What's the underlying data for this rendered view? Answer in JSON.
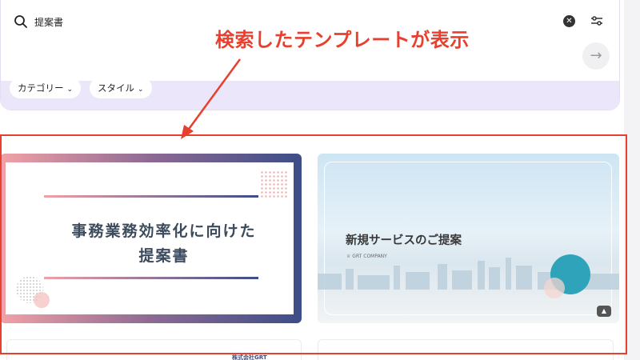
{
  "search": {
    "query": "提案書",
    "icon": "search-icon",
    "clear_icon": "close-circle-icon",
    "filter_icon": "sliders-icon",
    "submit_icon": "arrow-right-icon",
    "submit_glyph": "→",
    "clear_glyph": "✕"
  },
  "filters": [
    {
      "label": "カテゴリー",
      "chevron": "⌄"
    },
    {
      "label": "スタイル",
      "chevron": "⌄"
    }
  ],
  "annotation": {
    "text": "検索したテンプレートが表示",
    "color": "#e8402f"
  },
  "templates": [
    {
      "title_line1": "事務業務効率化に向けた",
      "title_line2": "提案書"
    },
    {
      "title": "新規サービスのご提案",
      "company": "GRT COMPANY",
      "badge_icon": "graduation-cap-icon",
      "badge_glyph": "🎓"
    },
    {
      "company_partial": "株式会社GRT"
    },
    {}
  ],
  "colors": {
    "accent_purple_bg": "#ece6fb",
    "highlight_red": "#e8402f",
    "teal": "#2ea3b9"
  }
}
